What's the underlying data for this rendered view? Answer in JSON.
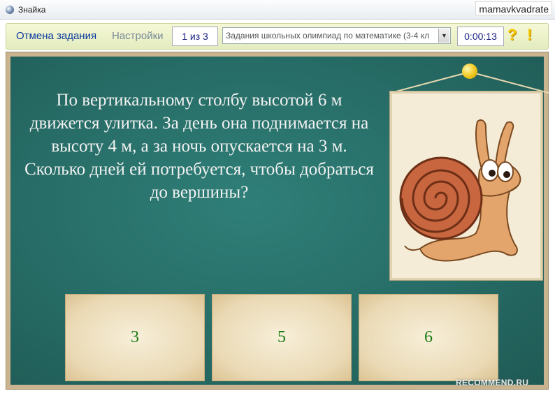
{
  "window": {
    "title": "Знайка",
    "user_watermark": "mamavkvadrate"
  },
  "toolbar": {
    "cancel_label": "Отмена задания",
    "settings_label": "Настройки",
    "counter": "1 из 3",
    "task_set": "Задания школьных олимпиад по математике (3-4 кл",
    "timer": "0:00:13",
    "help_label": "?",
    "hint_label": "!"
  },
  "question": {
    "text": "По вертикальному столбу высотой 6 м движется улитка. За день она поднимается на высоту 4 м, а за ночь опускается на 3 м. Сколько дней ей потребуется, чтобы добраться до вершины?"
  },
  "answers": [
    {
      "label": "3"
    },
    {
      "label": "5"
    },
    {
      "label": "6"
    }
  ],
  "site_watermark": "RECOMMEND.RU",
  "colors": {
    "board": "#276c66",
    "frame": "#c9b48f",
    "answer_text": "#1b7a12",
    "toolbar": "#eef3cf"
  }
}
